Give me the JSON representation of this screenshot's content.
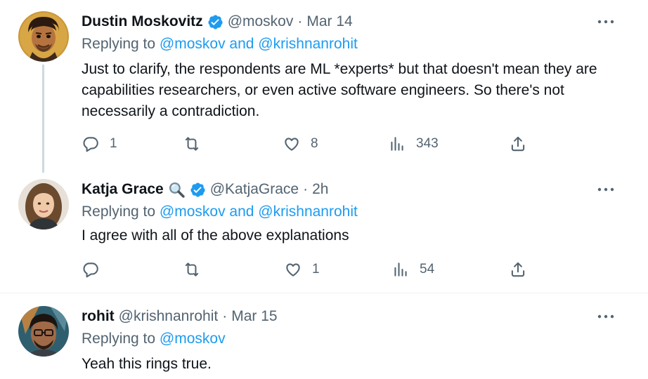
{
  "tweets": [
    {
      "name": "Dustin Moskovitz",
      "handle": "@moskov",
      "separator": "·",
      "time": "Mar 14",
      "reply_prefix": "Replying to ",
      "reply_targets": "@moskov and @krishnanrohit",
      "text": "Just to clarify, the respondents are ML *experts* but that doesn't mean they are capabilities researchers, or even active software engineers. So there's not necessarily a contradiction.",
      "stats": {
        "replies": "1",
        "retweets": "",
        "likes": "8",
        "views": "343"
      }
    },
    {
      "name": "Katja Grace",
      "handle": "@KatjaGrace",
      "separator": "·",
      "time": "2h",
      "reply_prefix": "Replying to ",
      "reply_targets": "@moskov and @krishnanrohit",
      "text": "I agree with all of the above explanations",
      "stats": {
        "replies": "",
        "retweets": "",
        "likes": "1",
        "views": "54"
      }
    },
    {
      "name": "rohit",
      "handle": "@krishnanrohit",
      "separator": "·",
      "time": "Mar 15",
      "reply_prefix": "Replying to ",
      "reply_targets": "@moskov",
      "text": "Yeah this rings true."
    }
  ],
  "icons": {
    "verified": "verified-badge-icon",
    "magnifier_emoji": "magnifying-glass-emoji",
    "more": "more-dots-icon",
    "reply": "reply-icon",
    "retweet": "retweet-icon",
    "like": "heart-icon",
    "views": "views-icon",
    "share": "share-icon"
  },
  "colors": {
    "link": "#1d9bf0",
    "secondary_text": "#536471",
    "primary_text": "#0f1419",
    "thread_line": "#cfd9de"
  }
}
